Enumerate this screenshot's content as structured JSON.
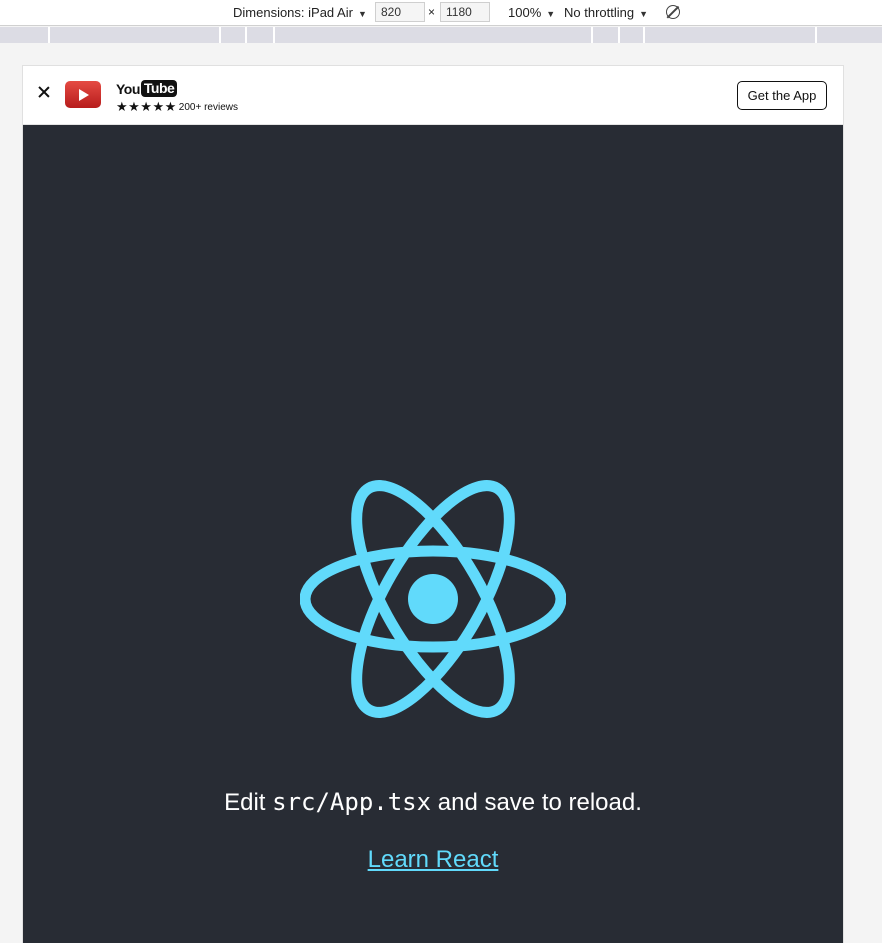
{
  "devtools": {
    "dimensions_label": "Dimensions: iPad Air",
    "width_value": "820",
    "times_sign": "×",
    "height_value": "1180",
    "zoom": "100%",
    "throttling": "No throttling",
    "caret": "▼"
  },
  "banner": {
    "logo_you": "You",
    "logo_tube": "Tube",
    "stars": "★★★★★",
    "reviews": "200+ reviews",
    "get_app_label": "Get the App"
  },
  "app": {
    "edit_prefix": "Edit ",
    "edit_code": "src/App.tsx",
    "edit_suffix": " and save to reload.",
    "learn_link": "Learn React"
  },
  "colors": {
    "app_background": "#282c34",
    "react_accent": "#61dafb",
    "youtube_red": "#d32f2f"
  },
  "icons": [
    "close-icon",
    "youtube-app-icon",
    "rotate-icon",
    "react-logo"
  ]
}
